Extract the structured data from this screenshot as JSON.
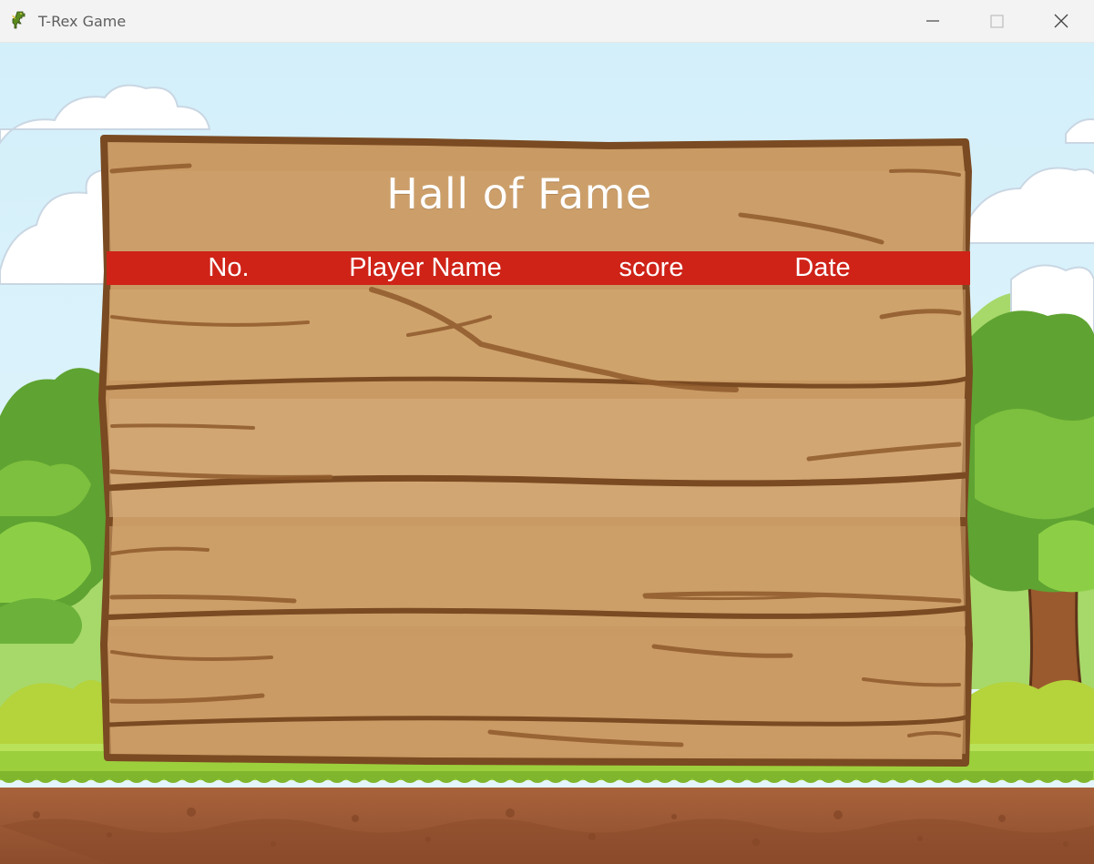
{
  "window": {
    "title": "T-Rex Game",
    "icon": "dinosaur-icon",
    "controls": [
      "minimize-icon",
      "maximize-icon",
      "close-icon"
    ]
  },
  "board": {
    "title": "Hall of Fame",
    "columns": {
      "no": "No.",
      "player_name": "Player Name",
      "score": "score",
      "date": "Date"
    },
    "rows": []
  },
  "colors": {
    "sky": "#d8f1fb",
    "header_bar": "#cf2318",
    "wood": "#c9965f",
    "wood_outline": "#7a4a22",
    "grass": "#9ccf3c",
    "soil": "#9c5a37"
  }
}
